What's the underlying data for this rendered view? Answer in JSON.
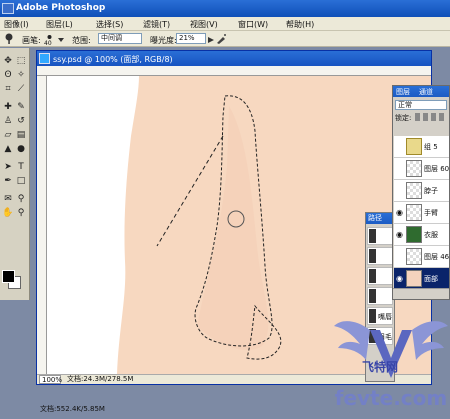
{
  "app": {
    "title": "Adobe Photoshop"
  },
  "menubar": {
    "items": [
      "图像(I)",
      "图层(L)",
      "选择(S)",
      "滤镜(T)",
      "视图(V)",
      "窗口(W)",
      "帮助(H)"
    ]
  },
  "options": {
    "brush_label": "画笔:",
    "brush_size": "40",
    "range_label": "范围:",
    "range_value": "中间调",
    "exposure_label": "曝光度:",
    "exposure_value": "21%"
  },
  "document": {
    "title": "ssy.psd @ 100% (面部, RGB/8)",
    "zoom": "100%",
    "doc_info": "文档:24.3M/278.5M"
  },
  "paths_panel": {
    "tab": "路径",
    "rows": [
      "嘴唇",
      "眉毛"
    ]
  },
  "layers_panel": {
    "tabs": [
      "图层",
      "通道"
    ],
    "blend_mode": "正常",
    "lock_label": "锁定:",
    "layers": [
      {
        "name": "组 5",
        "kind": "folder",
        "visible": false,
        "selected": false
      },
      {
        "name": "图层 60",
        "kind": "plain",
        "visible": false,
        "selected": false
      },
      {
        "name": "脖子",
        "kind": "plain",
        "visible": false,
        "selected": false
      },
      {
        "name": "手臂",
        "kind": "plain",
        "visible": true,
        "selected": false
      },
      {
        "name": "衣服",
        "kind": "green",
        "visible": true,
        "selected": false
      },
      {
        "name": "图层 46",
        "kind": "plain",
        "visible": false,
        "selected": false
      },
      {
        "name": "面部",
        "kind": "skin",
        "visible": true,
        "selected": true
      }
    ]
  },
  "bottom_status": {
    "info": "文档:552.4K/5.85M"
  },
  "watermark": {
    "text": "fevte.com",
    "cn_text": "飞特网"
  },
  "colors": {
    "skin": "#f7d8c0",
    "title_blue": "#1c5bc4",
    "selected_layer": "#0a246a"
  }
}
